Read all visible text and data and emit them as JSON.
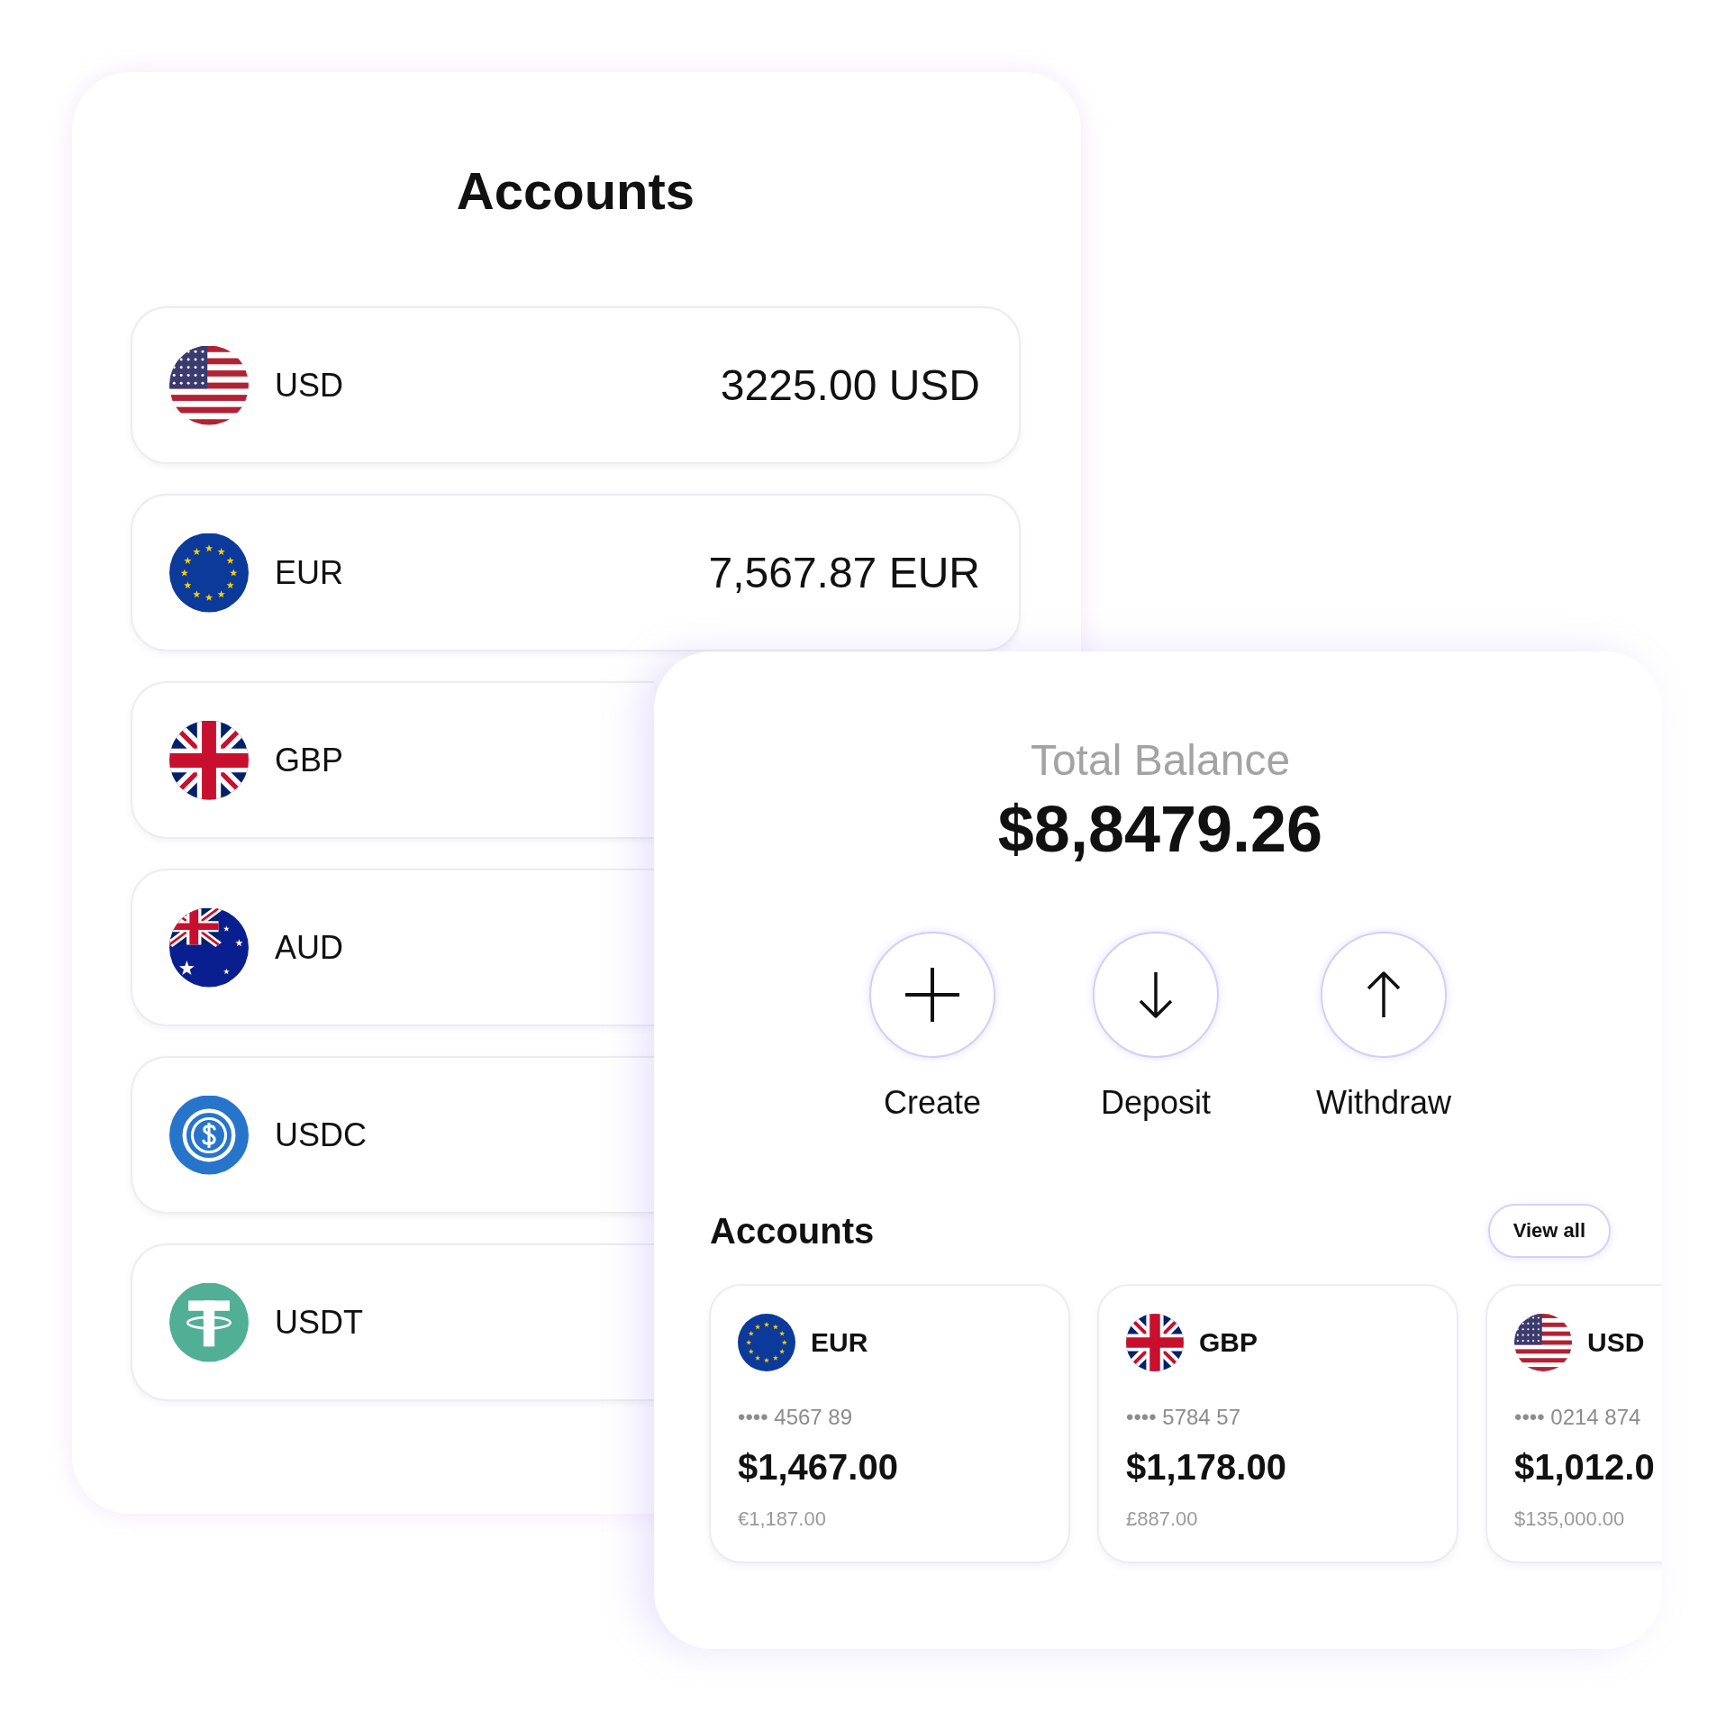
{
  "accounts_panel": {
    "title": "Accounts",
    "accounts": [
      {
        "kind": "usa",
        "code": "USD",
        "amount": "3225.00 USD"
      },
      {
        "kind": "eu",
        "code": "EUR",
        "amount": "7,567.87 EUR"
      },
      {
        "kind": "uk",
        "code": "GBP"
      },
      {
        "kind": "australia",
        "code": "AUD"
      },
      {
        "kind": "usdc",
        "code": "USDC"
      },
      {
        "kind": "tether",
        "code": "USDT"
      }
    ]
  },
  "balance_panel": {
    "balance_label": "Total Balance",
    "balance": "$8,8479.26",
    "actions": [
      {
        "kind": "create",
        "label": "Create"
      },
      {
        "kind": "deposit",
        "label": "Deposit"
      },
      {
        "kind": "withdraw",
        "label": "Withdraw"
      }
    ],
    "accounts_heading": "Accounts",
    "view_all": "View all",
    "accounts": [
      {
        "kind": "eu",
        "code": "EUR",
        "number": "•••• 4567 89",
        "balance": "$1,467.00",
        "converted": "€1,187.00"
      },
      {
        "kind": "uk",
        "code": "GBP",
        "number": "•••• 5784 57",
        "balance": "$1,178.00",
        "converted": "£887.00"
      },
      {
        "kind": "usa",
        "code": "USD",
        "number": "•••• 0214 874",
        "balance": "$1,012.0",
        "converted": "$135,000.00"
      }
    ]
  }
}
